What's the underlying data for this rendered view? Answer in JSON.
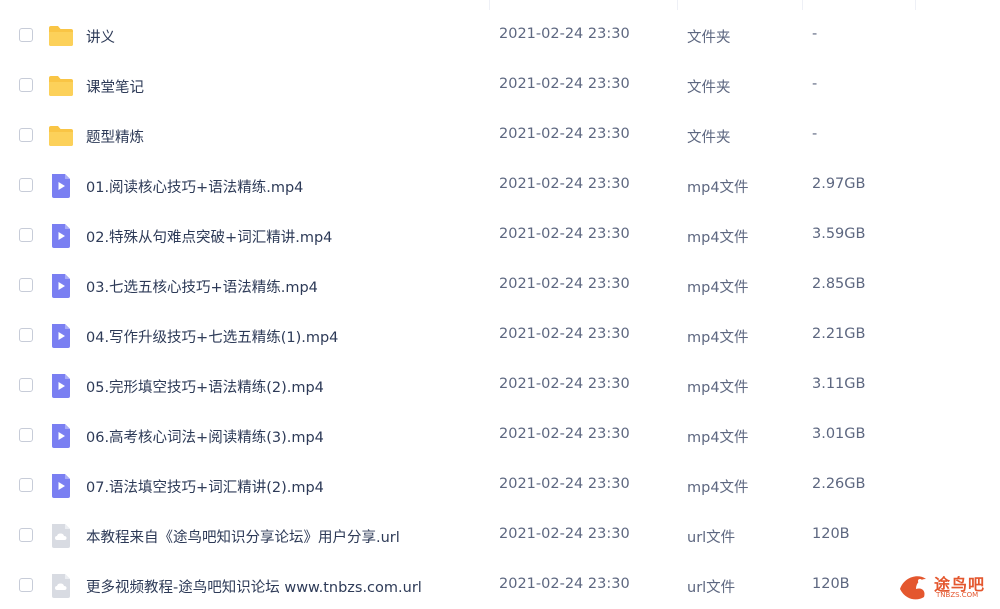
{
  "files": [
    {
      "name": "讲义",
      "date": "2021-02-24 23:30",
      "type": "文件夹",
      "size": "-",
      "icon": "folder-icon"
    },
    {
      "name": "课堂笔记",
      "date": "2021-02-24 23:30",
      "type": "文件夹",
      "size": "-",
      "icon": "folder-icon"
    },
    {
      "name": "题型精炼",
      "date": "2021-02-24 23:30",
      "type": "文件夹",
      "size": "-",
      "icon": "folder-icon"
    },
    {
      "name": "01.阅读核心技巧+语法精练.mp4",
      "date": "2021-02-24 23:30",
      "type": "mp4文件",
      "size": "2.97GB",
      "icon": "video-file-icon"
    },
    {
      "name": "02.特殊从句难点突破+词汇精讲.mp4",
      "date": "2021-02-24 23:30",
      "type": "mp4文件",
      "size": "3.59GB",
      "icon": "video-file-icon"
    },
    {
      "name": "03.七选五核心技巧+语法精练.mp4",
      "date": "2021-02-24 23:30",
      "type": "mp4文件",
      "size": "2.85GB",
      "icon": "video-file-icon"
    },
    {
      "name": "04.写作升级技巧+七选五精练(1).mp4",
      "date": "2021-02-24 23:30",
      "type": "mp4文件",
      "size": "2.21GB",
      "icon": "video-file-icon"
    },
    {
      "name": "05.完形填空技巧+语法精练(2).mp4",
      "date": "2021-02-24 23:30",
      "type": "mp4文件",
      "size": "3.11GB",
      "icon": "video-file-icon"
    },
    {
      "name": "06.高考核心词法+阅读精练(3).mp4",
      "date": "2021-02-24 23:30",
      "type": "mp4文件",
      "size": "3.01GB",
      "icon": "video-file-icon"
    },
    {
      "name": "07.语法填空技巧+词汇精讲(2).mp4",
      "date": "2021-02-24 23:30",
      "type": "mp4文件",
      "size": "2.26GB",
      "icon": "video-file-icon"
    },
    {
      "name": "本教程来自《途鸟吧知识分享论坛》用户分享.url",
      "date": "2021-02-24 23:30",
      "type": "url文件",
      "size": "120B",
      "icon": "url-file-icon"
    },
    {
      "name": "更多视频教程-途鸟吧知识论坛 www.tnbzs.com.url",
      "date": "2021-02-24 23:30",
      "type": "url文件",
      "size": "120B",
      "icon": "url-file-icon"
    }
  ],
  "watermark": {
    "text": "途鸟吧",
    "sub": "TNBZS.COM"
  },
  "colors": {
    "folder": "#f9c545",
    "video": "#7a7ff2",
    "url": "#d8dbe2"
  }
}
